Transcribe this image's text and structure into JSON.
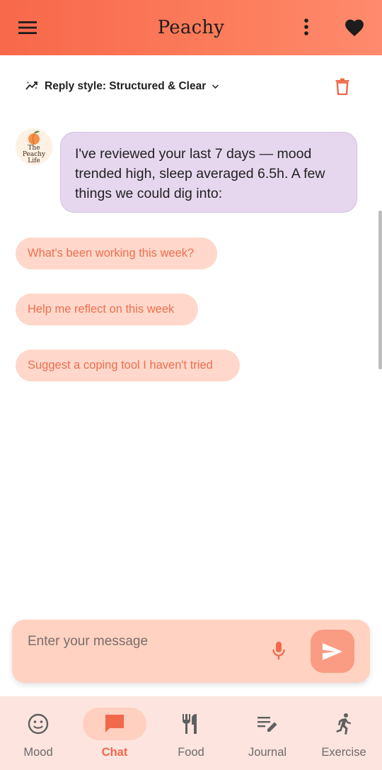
{
  "app_bar": {
    "title": "Peachy",
    "menu_icon": "hamburger-menu-icon",
    "more_icon": "more-vertical-icon",
    "favorite_icon": "heart-icon"
  },
  "toolbar": {
    "reply_style_label": "Reply style: Structured & Clear",
    "reply_style_icon": "trending-icon",
    "dropdown_icon": "chevron-down-icon",
    "delete_icon": "trash-icon"
  },
  "chat": {
    "avatar_text": [
      "The",
      "Peachy",
      "Life"
    ],
    "message": "I've reviewed your last 7 days — mood trended high, sleep averaged 6.5h. A few things we could dig into:",
    "suggestions": [
      "What's been working this week?",
      "Help me reflect on this week",
      "Suggest a coping tool I haven't tried"
    ]
  },
  "composer": {
    "placeholder": "Enter your message",
    "mic_icon": "microphone-icon",
    "send_icon": "send-icon"
  },
  "bottom_nav": {
    "active": "Chat",
    "items": [
      {
        "label": "Mood",
        "icon": "smiley-icon"
      },
      {
        "label": "Chat",
        "icon": "chat-bubble-icon"
      },
      {
        "label": "Food",
        "icon": "utensils-icon"
      },
      {
        "label": "Journal",
        "icon": "edit-note-icon"
      },
      {
        "label": "Exercise",
        "icon": "running-person-icon"
      }
    ]
  },
  "colors": {
    "accent": "#f8684a",
    "bubble": "#e6d7ef",
    "chip_bg": "#ffd8cb",
    "chip_text": "#ec6f4f",
    "nav_bg": "#fde4de"
  }
}
